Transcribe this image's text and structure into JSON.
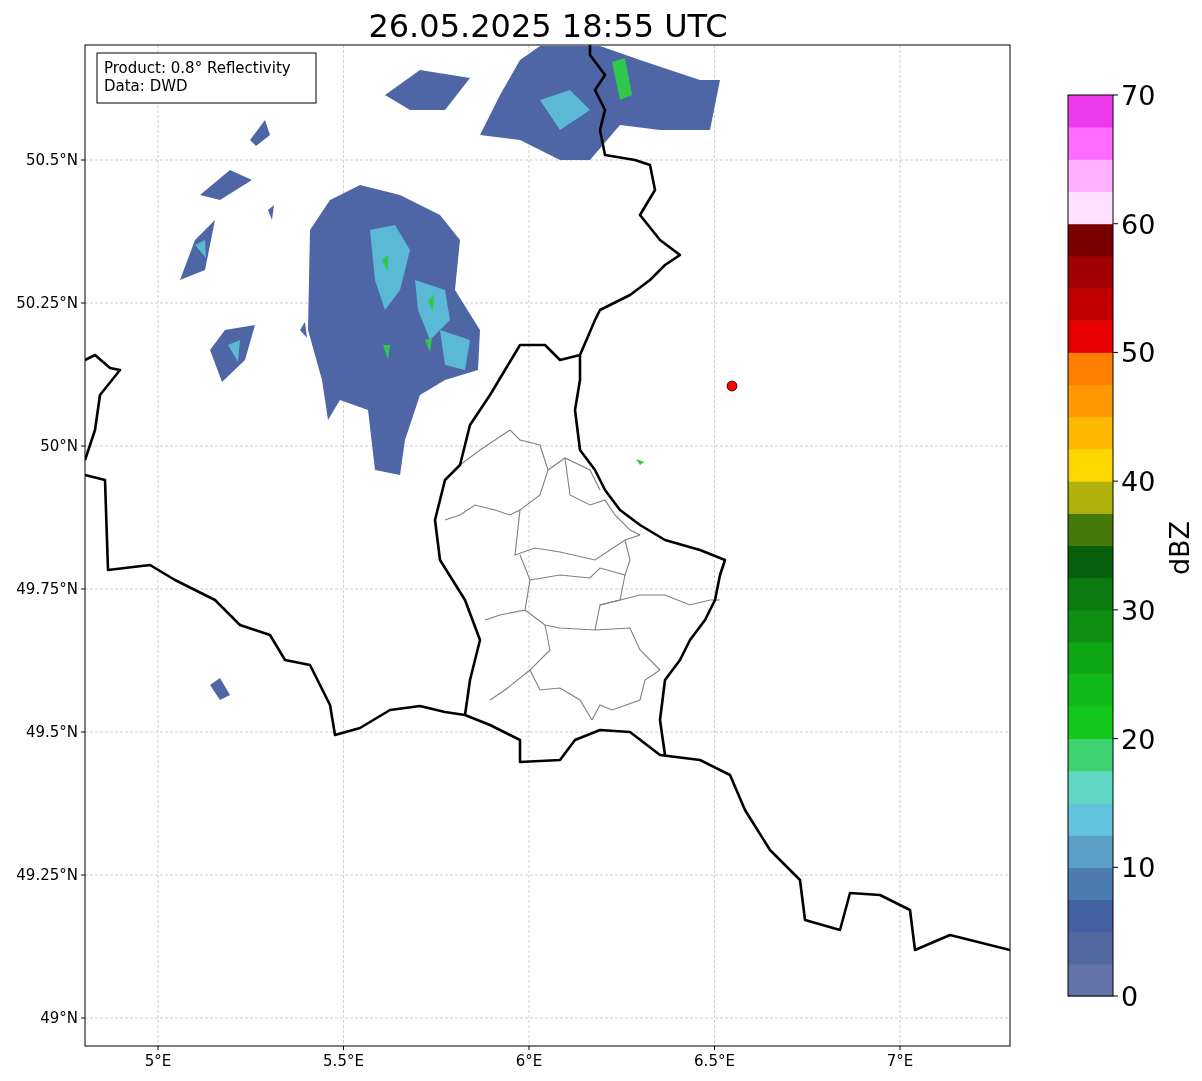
{
  "title": "26.05.2025 18:55 UTC",
  "map": {
    "legend": [
      "Product: 0.8° Reflectivity",
      "Data: DWD"
    ],
    "y_ticks": [
      "50.5°N",
      "50.25°N",
      "50°N",
      "49.75°N",
      "49.5°N",
      "49.25°N",
      "49°N"
    ],
    "x_ticks": [
      "5°E",
      "5.5°E",
      "6°E",
      "6.5°E",
      "7°E"
    ]
  },
  "colorbar": {
    "label": "dBZ",
    "ticks": [
      "70",
      "60",
      "50",
      "40",
      "30",
      "20",
      "10",
      "0"
    ],
    "bins": [
      {
        "color": "#6474a8"
      },
      {
        "color": "#5468a0"
      },
      {
        "color": "#4361a2"
      },
      {
        "color": "#4b7bb1"
      },
      {
        "color": "#5a9fc6"
      },
      {
        "color": "#64c3dc"
      },
      {
        "color": "#5fd7c3"
      },
      {
        "color": "#3dd370"
      },
      {
        "color": "#12c81a"
      },
      {
        "color": "#11b91a"
      },
      {
        "color": "#10a714"
      },
      {
        "color": "#0e8f12"
      },
      {
        "color": "#0b7a0f"
      },
      {
        "color": "#065f0a"
      },
      {
        "color": "#457a0a"
      },
      {
        "color": "#b0b00a"
      },
      {
        "color": "#ffd700"
      },
      {
        "color": "#ffb800"
      },
      {
        "color": "#ff9900"
      },
      {
        "color": "#ff7f00"
      },
      {
        "color": "#e60000"
      },
      {
        "color": "#c00000"
      },
      {
        "color": "#a00000"
      },
      {
        "color": "#7a0000"
      },
      {
        "color": "#ffe0ff"
      },
      {
        "color": "#ffb0ff"
      },
      {
        "color": "#ff6aff"
      },
      {
        "color": "#ee38ee"
      }
    ]
  }
}
